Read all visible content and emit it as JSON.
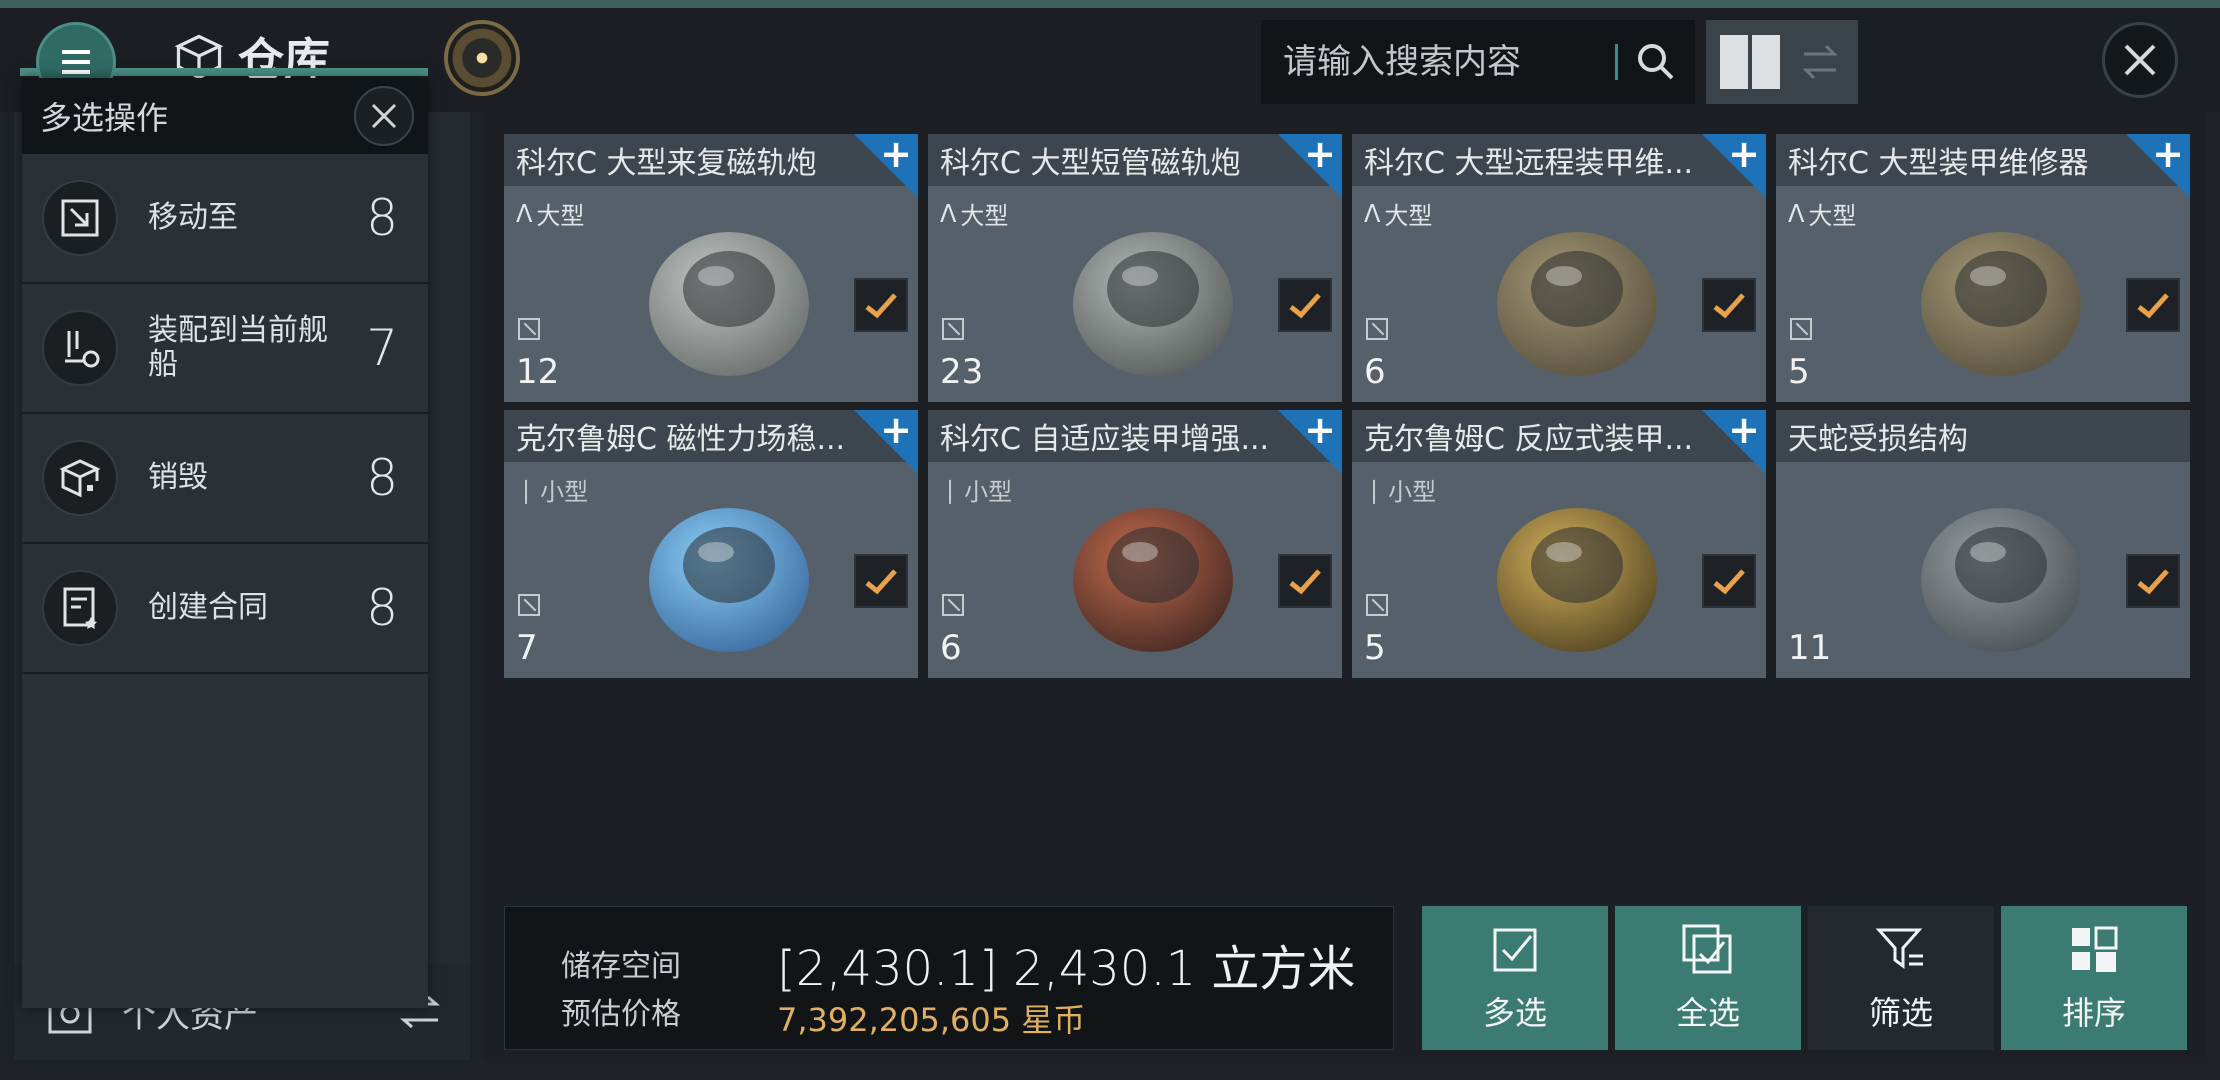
{
  "header": {
    "title": "仓库",
    "search_placeholder": "请输入搜索内容"
  },
  "sidebar": {
    "personal_assets": "个人资产"
  },
  "popup": {
    "title": "多选操作",
    "items": [
      {
        "label": "移动至",
        "count": "8",
        "icon": "move-to-icon"
      },
      {
        "label": "装配到当前舰船",
        "count": "7",
        "icon": "fit-ship-icon"
      },
      {
        "label": "销毁",
        "count": "8",
        "icon": "destroy-icon"
      },
      {
        "label": "创建合同",
        "count": "8",
        "icon": "contract-icon"
      }
    ]
  },
  "cards": [
    {
      "title": "科尔C 大型来复磁轨炮",
      "size": "大型",
      "count": "12",
      "checked": true,
      "plus": true
    },
    {
      "title": "科尔C 大型短管磁轨炮",
      "size": "大型",
      "count": "23",
      "checked": true,
      "plus": true
    },
    {
      "title": "科尔C 大型远程装甲维...",
      "size": "大型",
      "count": "6",
      "checked": true,
      "plus": true
    },
    {
      "title": "科尔C 大型装甲维修器",
      "size": "大型",
      "count": "5",
      "checked": true,
      "plus": true
    },
    {
      "title": "克尔鲁姆C 磁性力场稳...",
      "size": "小型",
      "count": "7",
      "checked": true,
      "plus": true
    },
    {
      "title": "科尔C 自适应装甲增强...",
      "size": "小型",
      "count": "6",
      "checked": true,
      "plus": true
    },
    {
      "title": "克尔鲁姆C 反应式装甲...",
      "size": "小型",
      "count": "5",
      "checked": true,
      "plus": true
    },
    {
      "title": "天蛇受损结构",
      "size": "",
      "count": "11",
      "checked": true,
      "plus": false
    }
  ],
  "storage": {
    "space_label": "储存空间",
    "price_label": "预估价格",
    "volume": "[2,430.1] 2,430.1 立方米",
    "price": "7,392,205,605 星币"
  },
  "actions": {
    "multi_select": "多选",
    "select_all": "全选",
    "filter": "筛选",
    "sort": "排序"
  },
  "colors": {
    "accent_teal": "#3b7b72",
    "price_gold": "#e0b060",
    "plus_blue": "#1e73b8"
  }
}
